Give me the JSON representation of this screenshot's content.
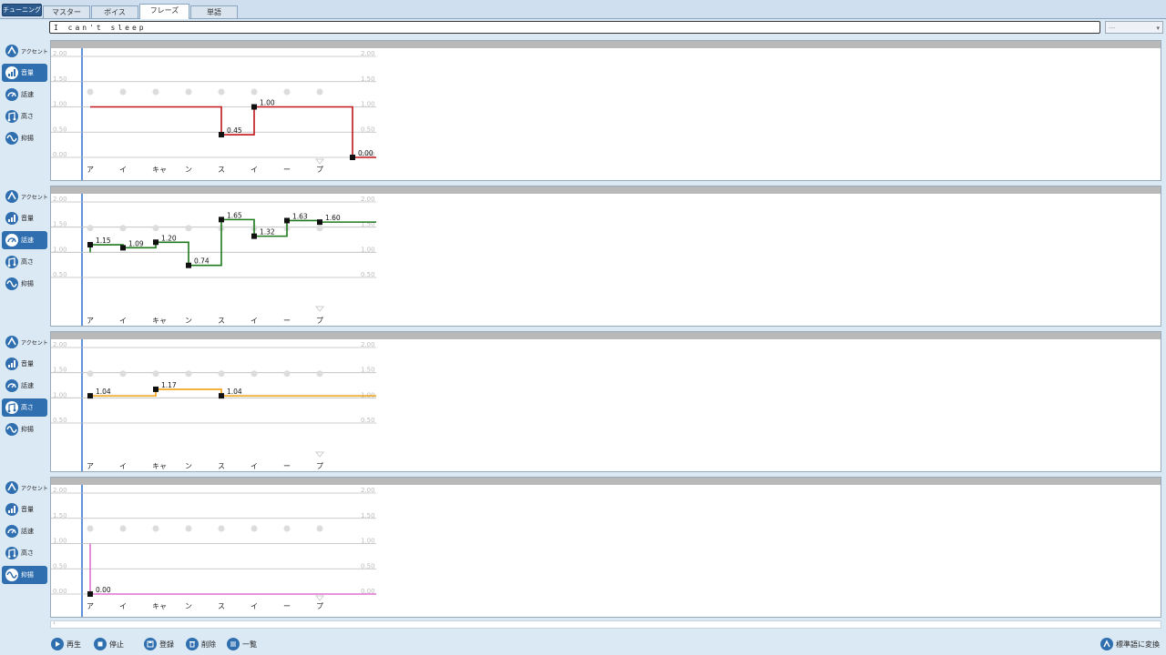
{
  "tuning_button": "チューニング",
  "tabs": [
    {
      "label": "マスター",
      "active": false
    },
    {
      "label": "ボイス",
      "active": false
    },
    {
      "label": "フレーズ",
      "active": true
    },
    {
      "label": "単語",
      "active": false
    }
  ],
  "phrase_text": "I can't sleep",
  "preset_select": "---",
  "sidebar_labels": [
    "アクセント",
    "音量",
    "話速",
    "高さ",
    "抑揚"
  ],
  "kana": [
    "ア",
    "イ",
    "キャ",
    "ン",
    "ス",
    "イ",
    "ー",
    "プ"
  ],
  "panels": [
    {
      "id": "volume",
      "active_index": 1,
      "color": "#c0161b",
      "axis_labels": [
        "2.00",
        "1.50",
        "1.00",
        "0.50",
        "0.00"
      ],
      "axis_values": [
        2.0,
        1.5,
        1.0,
        0.5,
        0.0
      ],
      "show_dots": true,
      "points": [
        {
          "k": 4,
          "v": 0.45,
          "label": "0.45"
        },
        {
          "k": 5,
          "v": 1.0,
          "label": "1.00"
        },
        {
          "k": 8,
          "v": 0.0,
          "label": "0.00"
        }
      ],
      "start_value": 1.0
    },
    {
      "id": "speed",
      "active_index": 2,
      "color": "#1c7a1c",
      "axis_labels": [
        "2.00",
        "1.50",
        "1.00",
        "0.50"
      ],
      "axis_values": [
        2.0,
        1.5,
        1.0,
        0.5
      ],
      "show_dots": true,
      "points": [
        {
          "k": 0,
          "v": 1.15,
          "label": "1.15"
        },
        {
          "k": 1,
          "v": 1.09,
          "label": "1.09"
        },
        {
          "k": 2,
          "v": 1.2,
          "label": "1.20"
        },
        {
          "k": 3,
          "v": 0.74,
          "label": "0.74"
        },
        {
          "k": 4,
          "v": 1.65,
          "label": "1.65"
        },
        {
          "k": 5,
          "v": 1.32,
          "label": "1.32"
        },
        {
          "k": 6,
          "v": 1.63,
          "label": "1.63"
        },
        {
          "k": 7,
          "v": 1.6,
          "label": "1.60"
        }
      ],
      "start_value": 1.0
    },
    {
      "id": "pitch",
      "active_index": 3,
      "color": "#f0a010",
      "axis_labels": [
        "2.00",
        "1.50",
        "1.00",
        "0.50"
      ],
      "axis_values": [
        2.0,
        1.5,
        1.0,
        0.5
      ],
      "show_dots": true,
      "points": [
        {
          "k": 0,
          "v": 1.04,
          "label": "1.04"
        },
        {
          "k": 2,
          "v": 1.17,
          "label": "1.17"
        },
        {
          "k": 4,
          "v": 1.04,
          "label": "1.04"
        }
      ],
      "start_value": 1.04
    },
    {
      "id": "intonation",
      "active_index": 4,
      "color": "#e070d0",
      "axis_labels": [
        "2.00",
        "1.50",
        "1.00",
        "0.50",
        "0.00"
      ],
      "axis_values": [
        2.0,
        1.5,
        1.0,
        0.5,
        0.0
      ],
      "show_dots": true,
      "points": [
        {
          "k": 0,
          "v": 0.0,
          "label": "0.00"
        }
      ],
      "start_value": 1.0
    }
  ],
  "bottom_buttons": [
    {
      "label": "再生",
      "enabled": false,
      "icon": "play-icon"
    },
    {
      "label": "停止",
      "enabled": true,
      "icon": "stop-icon"
    },
    {
      "label": "登録",
      "enabled": false,
      "icon": "save-icon"
    },
    {
      "label": "削除",
      "enabled": false,
      "icon": "delete-icon"
    },
    {
      "label": "一覧",
      "enabled": true,
      "icon": "list-icon"
    }
  ],
  "convert_button": "標準語に変換"
}
